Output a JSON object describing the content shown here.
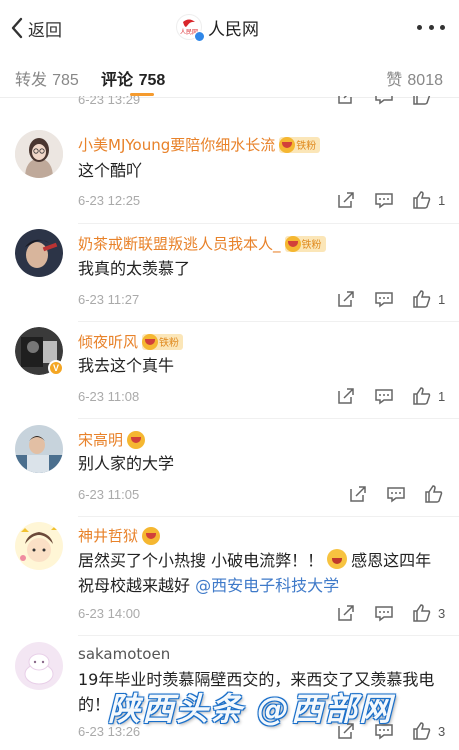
{
  "topbar": {
    "back_label": "返回",
    "title": "人民网"
  },
  "tabs": {
    "repost_label": "转发",
    "repost_count": "785",
    "comment_label": "评论",
    "comment_count": "758",
    "like_label": "赞",
    "like_count": "8018"
  },
  "partial_time": "6-23 13:29",
  "comments": [
    {
      "username": "小美MJYoung要陪你细水长流",
      "badge": "铁粉",
      "text": "这个酷吖",
      "time": "6-23 12:25",
      "likes": "1"
    },
    {
      "username": "奶茶戒断联盟叛逃人员我本人_",
      "badge": "铁粉",
      "text": "我真的太羡慕了",
      "time": "6-23 11:27",
      "likes": "1"
    },
    {
      "username": "倾夜听风",
      "badge": "铁粉",
      "text": "我去这个真牛",
      "time": "6-23 11:08",
      "likes": "1"
    },
    {
      "username": "宋高明",
      "badge": "",
      "text": "别人家的大学",
      "time": "6-23 11:05",
      "likes": ""
    },
    {
      "username": "神井哲狱",
      "badge": "",
      "text_part1": "居然买了个小热搜 小破电流弊！！",
      "text_part2": "感恩这四年 祝母校越来越好",
      "mention": "@西安电子科技大学",
      "time": "6-23 14:00",
      "likes": "3"
    },
    {
      "username": "sakamotoen",
      "badge": "",
      "text": "19年毕业时羡慕隔壁西交的，来西交了又羡慕我电的！",
      "time": "6-23 13:26",
      "likes": "3"
    }
  ],
  "watermark": "陕西头条 @西部网",
  "colors": {
    "username": "#e8822a",
    "tab_underline": "#f59b2e",
    "mention": "#3f7ac9"
  }
}
